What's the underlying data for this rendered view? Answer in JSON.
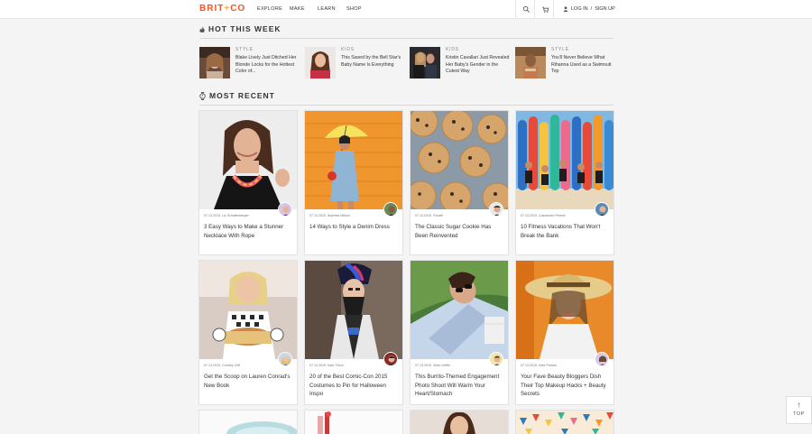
{
  "nav": {
    "logo_left": "BRIT",
    "logo_plus": "+",
    "logo_right": "CO",
    "menu": [
      "EXPLORE",
      "MAKE",
      "LEARN",
      "SHOP"
    ],
    "login": "LOG IN",
    "divider": "/",
    "signup": "SIGN UP"
  },
  "hot": {
    "title": "HOT THIS WEEK",
    "items": [
      {
        "category": "STYLE",
        "text": "Blake Lively Just Ditched Her Blonde Locks for the Hottest Color of..."
      },
      {
        "category": "KIDS",
        "text": "This Saved by the Bell Star's Baby Name Is Everything"
      },
      {
        "category": "KIDS",
        "text": "Kristin Cavallari Just Revealed Her Baby's Gender in the Cutest Way"
      },
      {
        "category": "STYLE",
        "text": "You'll Never Believe What Rihanna Used as a Swimsuit Top"
      }
    ]
  },
  "recent": {
    "title": "MOST RECENT",
    "cards": [
      {
        "date": "07.13.2015",
        "author": "Liz Schallenberger",
        "title": "3 Easy Ways to Make a Stunner Necklace With Rope"
      },
      {
        "date": "07.13.2015",
        "author": "Anjeriba Wilson",
        "title": "14 Ways to Style a Denim Dress"
      },
      {
        "date": "07.13.2015",
        "author": "Foodie",
        "title": "The Classic Sugar Cookie Has Been Reinvented"
      },
      {
        "date": "07.13.2015",
        "author": "Cassandra Pearse",
        "title": "10 Fitness Vacations That Won't Break the Bank"
      },
      {
        "date": "07.13.2015",
        "author": "Cortney Cliff",
        "title": "Get the Scoop on Lauren Conrad's New Book"
      },
      {
        "date": "07.13.2015",
        "author": "Kate Thorn",
        "title": "20 of the Best Comic-Con 2015 Costumes to Pin for Halloween Inspo"
      },
      {
        "date": "07.13.2015",
        "author": "Sean Griffin",
        "title": "This Burrito-Themed Engagement Photo Shoot Will Warm Your Heart/Stomach"
      },
      {
        "date": "07.13.2015",
        "author": "Kate Pahala",
        "title": "Your Fave Beauty Bloggers Dish Their Top Makeup Hacks + Beauty Secrets"
      }
    ]
  },
  "top_button": {
    "arrow": "↑",
    "label": "TOP"
  },
  "icons": {
    "search": "search-icon",
    "cart": "cart-icon",
    "user": "user-icon",
    "fire": "fire-icon",
    "clock": "clock-icon"
  },
  "colors": {
    "brand_red": "#f4562b",
    "brand_yellow": "#f9b02a",
    "background": "#f4f4f4"
  }
}
